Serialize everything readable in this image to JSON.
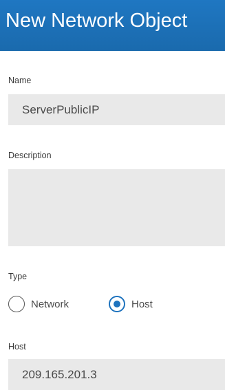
{
  "dialog": {
    "title": "New Network Object"
  },
  "form": {
    "name": {
      "label": "Name",
      "value": "ServerPublicIP"
    },
    "description": {
      "label": "Description",
      "value": ""
    },
    "type": {
      "label": "Type",
      "options": [
        {
          "label": "Network",
          "selected": false
        },
        {
          "label": "Host",
          "selected": true
        }
      ]
    },
    "host": {
      "label": "Host",
      "value": "209.165.201.3"
    }
  },
  "colors": {
    "title_bar": "#1e73be",
    "field_background": "#e9e9e9",
    "radio_selected": "#1e73be"
  }
}
